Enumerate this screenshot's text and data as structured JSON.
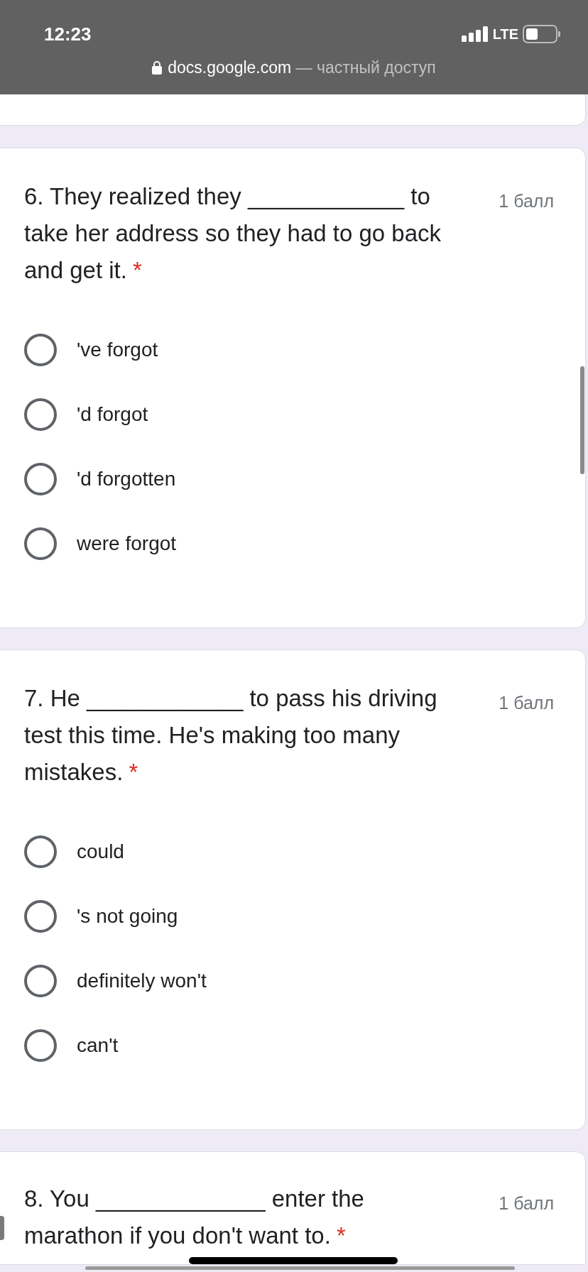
{
  "status_bar": {
    "time": "12:23",
    "network": "LTE"
  },
  "address_bar": {
    "domain": "docs.google.com",
    "suffix": "— частный доступ"
  },
  "questions": [
    {
      "text": "6. They realized they ____________ to take her address so they had to go back and get it.",
      "required_mark": "*",
      "points": "1 балл",
      "options": [
        {
          "label": "'ve forgot",
          "selected": false
        },
        {
          "label": "'d forgot",
          "selected": false
        },
        {
          "label": "'d forgotten",
          "selected": false
        },
        {
          "label": "were forgot",
          "selected": false
        }
      ]
    },
    {
      "text": "7. He ____________ to pass his driving test this time. He's making too many mistakes.",
      "required_mark": "*",
      "points": "1 балл",
      "options": [
        {
          "label": "could",
          "selected": false
        },
        {
          "label": "'s not going",
          "selected": false
        },
        {
          "label": "definitely won't",
          "selected": false
        },
        {
          "label": "can't",
          "selected": false
        }
      ]
    },
    {
      "text": "8. You _____________ enter the marathon if you don't want to.",
      "required_mark": "*",
      "points": "1 балл"
    }
  ]
}
